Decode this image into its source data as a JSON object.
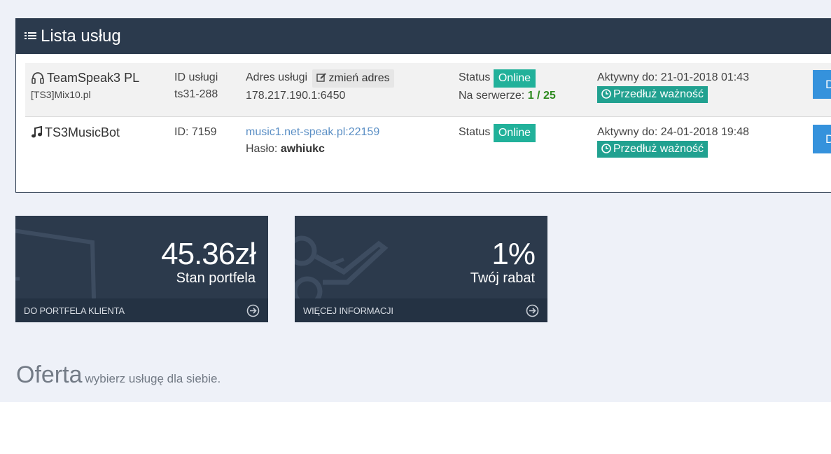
{
  "panel": {
    "title": "Lista usług",
    "icon": "list-icon"
  },
  "services": [
    {
      "icon": "headphones-icon",
      "name": "TeamSpeak3 PL",
      "sub": "[TS3]Mix10.pl",
      "id_label": "ID usługi",
      "id_value": "ts31-288",
      "address_label": "Adres usługi",
      "change_address": "zmień adres",
      "address": "178.217.190.1:6450",
      "status_label": "Status",
      "status": "Online",
      "server_label": "Na serwerze:",
      "server_count": "1 / 25",
      "active": "Aktywny do: 21-01-2018 01:43",
      "extend": "Przedłuż ważność",
      "action": "Da"
    },
    {
      "icon": "music-note-icon",
      "name": "TS3MusicBot",
      "id_text": "ID: 7159",
      "address": "music1.net-speak.pl:22159",
      "password_label": "Hasło:",
      "password": "awhiukc",
      "status_label": "Status",
      "status": "Online",
      "active": "Aktywny do: 24-01-2018 19:48",
      "extend": "Przedłuż ważność",
      "action": "Da"
    }
  ],
  "tiles": [
    {
      "value": "45.36zł",
      "label": "Stan portfela",
      "footer": "DO PORTFELA KLIENTA",
      "icon": "wallet-icon"
    },
    {
      "value": "1%",
      "label": "Twój rabat",
      "footer": "WIĘCEJ INFORMACJI",
      "icon": "scissors-icon"
    }
  ],
  "offer": {
    "title": "Oferta",
    "subtitle": "wybierz usługę dla siebie."
  },
  "colors": {
    "header": "#2b3a4d",
    "online": "#21b19a",
    "extend": "#21a190",
    "action": "#3592dc",
    "background": "#eef1f8"
  }
}
